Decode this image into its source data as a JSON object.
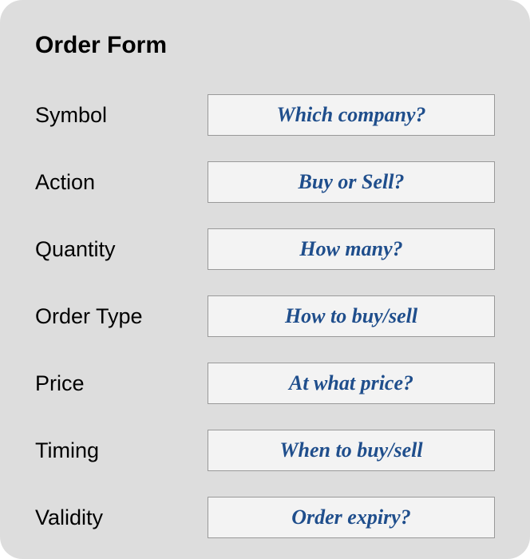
{
  "form": {
    "title": "Order Form",
    "fields": [
      {
        "label": "Symbol",
        "hint": "Which company?"
      },
      {
        "label": "Action",
        "hint": "Buy or Sell?"
      },
      {
        "label": "Quantity",
        "hint": "How many?"
      },
      {
        "label": "Order Type",
        "hint": "How to buy/sell"
      },
      {
        "label": "Price",
        "hint": "At what price?"
      },
      {
        "label": "Timing",
        "hint": "When to buy/sell"
      },
      {
        "label": "Validity",
        "hint": "Order expiry?"
      }
    ]
  }
}
